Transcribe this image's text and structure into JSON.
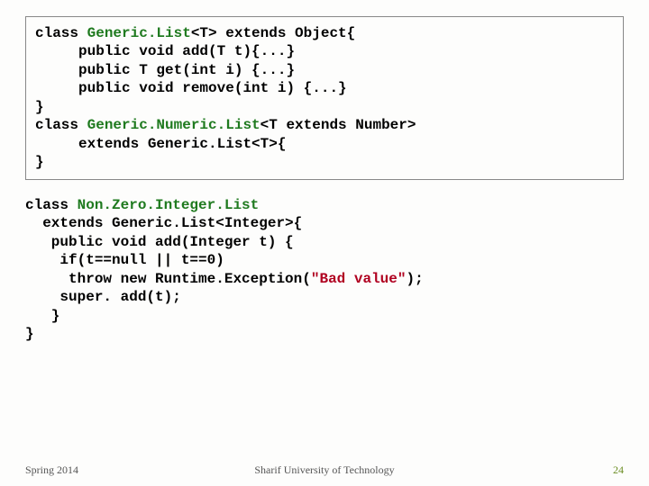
{
  "block1": {
    "l1a": "class ",
    "l1b": "Generic.List",
    "l1c": "<T> extends Object{",
    "l2": "     public void add(T t){...}",
    "l3": "     public T get(int i) {...}",
    "l4": "     public void remove(int i) {...}",
    "l5": "}",
    "l6a": "class ",
    "l6b": "Generic.Numeric.List",
    "l6c": "<T extends Number>",
    "l7": "     extends Generic.List<T>{",
    "l8": "}"
  },
  "block2": {
    "l1a": "class ",
    "l1b": "Non.Zero.Integer.List",
    "l2": "  extends Generic.List<Integer>{",
    "l3": "   public void add(Integer t) {",
    "l4": "    if(t==null || t==0)",
    "l5a": "     throw new Runtime.Exception(",
    "l5b": "\"Bad value\"",
    "l5c": ");",
    "l6": "    super. add(t);",
    "l7": "   }",
    "l8": "}"
  },
  "footer": {
    "left": "Spring 2014",
    "center": "Sharif University of Technology",
    "right": "24"
  }
}
